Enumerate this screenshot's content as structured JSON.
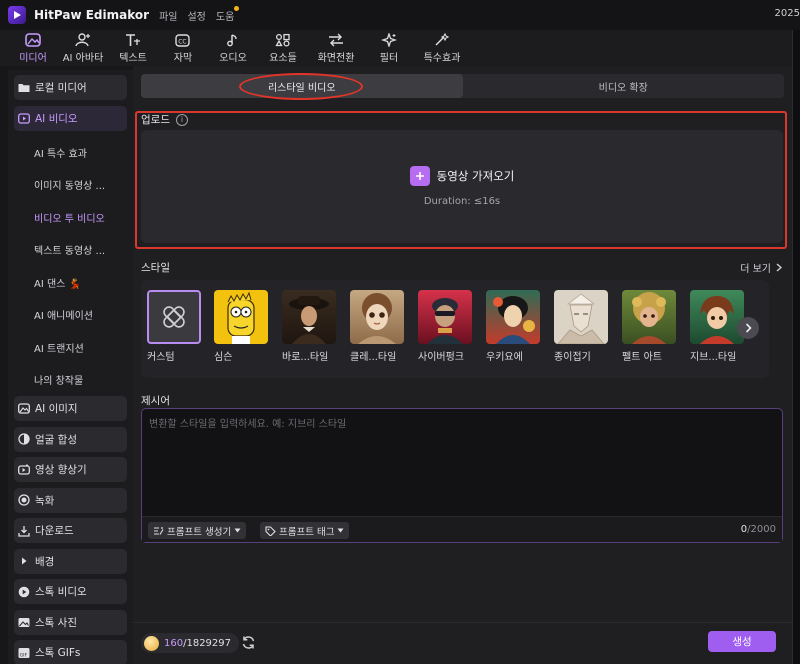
{
  "app": {
    "title": "HitPaw Edimakor",
    "menu": [
      "파일",
      "설정",
      "도움"
    ],
    "right_text": "2025"
  },
  "tabs": [
    {
      "label": "미디어",
      "icon": "media-icon",
      "active": true
    },
    {
      "label": "AI 아바타",
      "icon": "avatar-icon"
    },
    {
      "label": "텍스트",
      "icon": "text-icon"
    },
    {
      "label": "자막",
      "icon": "caption-icon"
    },
    {
      "label": "오디오",
      "icon": "music-icon"
    },
    {
      "label": "요소들",
      "icon": "elements-icon"
    },
    {
      "label": "화면전환",
      "icon": "transition-icon"
    },
    {
      "label": "필터",
      "icon": "filter-icon"
    },
    {
      "label": "특수효과",
      "icon": "effects-icon"
    }
  ],
  "sidebar": {
    "local_media": "로컬 미디어",
    "ai_video": "AI 비디오",
    "sub_items": [
      "AI 특수 효과",
      "이미지 동영상 ...",
      "비디오 투 비디오",
      "텍스트 동영상 ...",
      "AI 댄스 💃",
      "AI 애니메이션",
      "AI 트랜지션",
      "나의 창작물"
    ],
    "items": [
      "AI 이미지",
      "얼굴 합성",
      "영상 향상기",
      "녹화",
      "다운로드",
      "배경",
      "스톡 비디오",
      "스톡 사진",
      "스톡 GIFs"
    ]
  },
  "main": {
    "segments": [
      "리스타일 비디오",
      "비디오 확장"
    ],
    "upload": {
      "label": "업로드",
      "button": "동영상 가져오기",
      "duration": "Duration: ≤16s"
    },
    "style": {
      "label": "스타일",
      "more": "더 보기",
      "items": [
        "커스텀",
        "심슨",
        "바로...타일",
        "클레...타일",
        "사이버펑크",
        "우키요에",
        "종이접기",
        "펠트 아트",
        "지브...타일"
      ]
    },
    "prompt": {
      "label": "제시어",
      "placeholder": "변환할 스타일을 입력하세요. 예: 지브리 스타일",
      "generator": "프롬프트 생성기",
      "tags": "프롬프트 태그",
      "count_current": "0",
      "count_max": "/2000"
    },
    "footer": {
      "credits_used": "160",
      "credits_total": "/1829297",
      "generate": "생성"
    }
  },
  "colors": {
    "accent": "#c89bff",
    "generate": "#a05ef0",
    "highlight": "#e2352a"
  }
}
